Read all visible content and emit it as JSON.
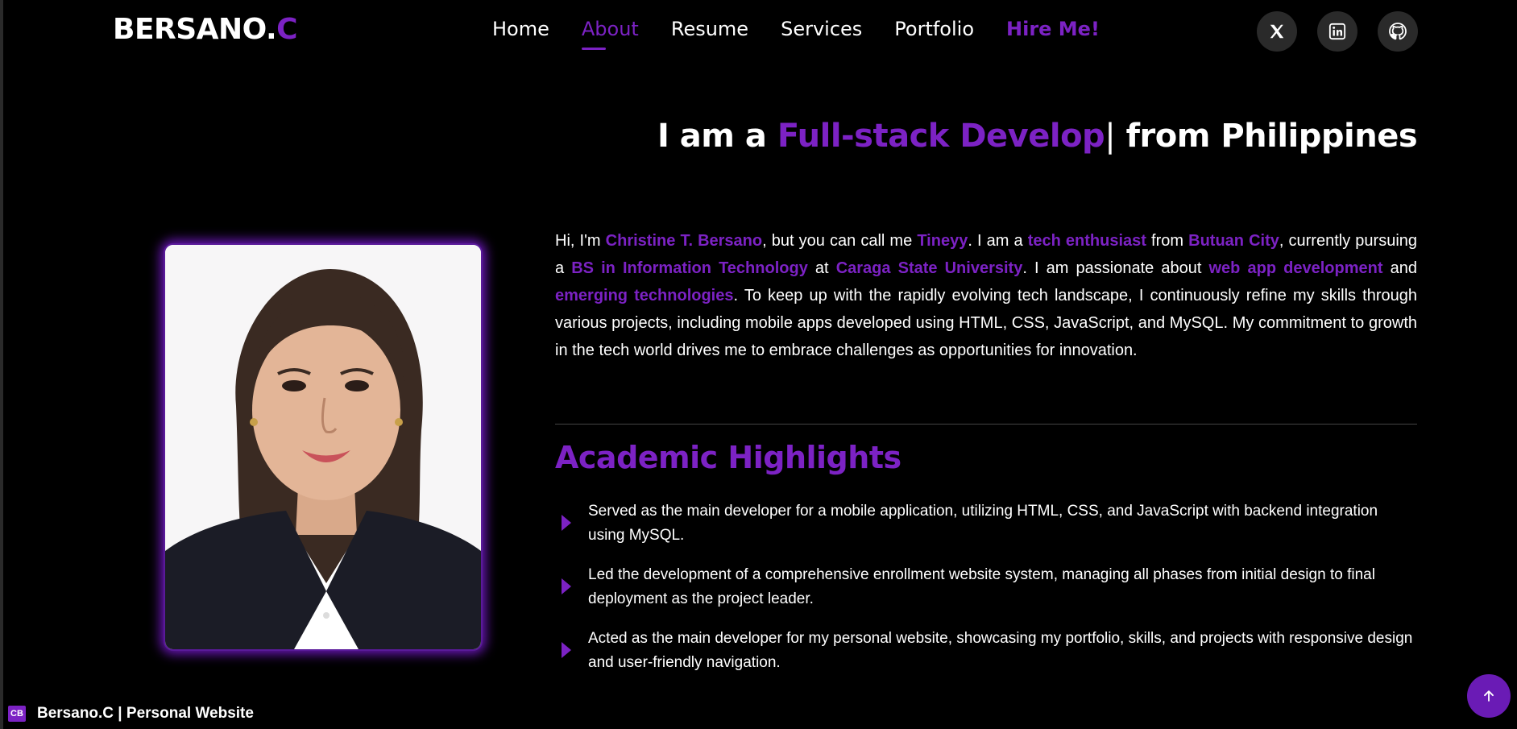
{
  "logo": {
    "text": "BERSANO.",
    "accent": "C"
  },
  "nav": {
    "items": [
      "Home",
      "About",
      "Resume",
      "Services",
      "Portfolio"
    ],
    "active": "About",
    "hire": "Hire Me!"
  },
  "social": [
    "x-icon",
    "linkedin-icon",
    "github-icon"
  ],
  "hero": {
    "prefix": "I am a ",
    "typed": "Full-stack Develop",
    "cursor": "|",
    "suffix": " from Philippines"
  },
  "about": {
    "segments": [
      [
        "Hi, I'm ",
        false
      ],
      [
        "Christine T. Bersano",
        true
      ],
      [
        ", but you can call me ",
        false
      ],
      [
        "Tineyy",
        true
      ],
      [
        ". I am a ",
        false
      ],
      [
        "tech enthusiast",
        true
      ],
      [
        " from ",
        false
      ],
      [
        "Butuan City",
        true
      ],
      [
        ", currently pursuing a ",
        false
      ],
      [
        "BS in Information Technology",
        true
      ],
      [
        " at ",
        false
      ],
      [
        "Caraga State University",
        true
      ],
      [
        ". I am passionate about ",
        false
      ],
      [
        "web app development",
        true
      ],
      [
        " and ",
        false
      ],
      [
        "emerging technologies",
        true
      ],
      [
        ". To keep up with the rapidly evolving tech landscape, I continuously refine my skills through various projects, including mobile apps developed using HTML, CSS, JavaScript, and MySQL. My commitment to growth in the tech world drives me to embrace challenges as opportunities for innovation.",
        false
      ]
    ]
  },
  "academic": {
    "title": "Academic Highlights",
    "items": [
      "Served as the main developer for a mobile application, utilizing HTML, CSS, and JavaScript with backend integration using MySQL.",
      "Led the development of a comprehensive enrollment website system, managing all phases from initial design to final deployment as the project leader.",
      "Acted as the main developer for my personal website, showcasing my portfolio, skills, and projects with responsive design and user-friendly navigation."
    ]
  },
  "footer": {
    "favicon": "CB",
    "title": "Bersano.C | Personal Website"
  },
  "colors": {
    "accent": "#7c22c4",
    "background": "#000000",
    "social_bg": "#2a2a2a"
  }
}
